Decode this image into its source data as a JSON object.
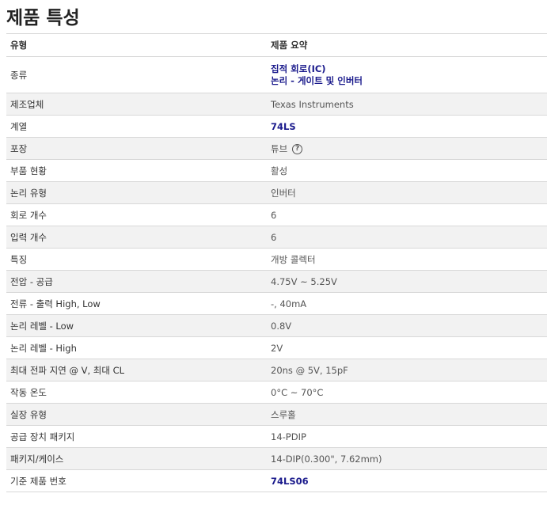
{
  "page_title": "제품 특성",
  "header": {
    "type_label": "유형",
    "summary_label": "제품 요약"
  },
  "rows": [
    {
      "name": "종류",
      "links": [
        "집적 회로(IC)",
        "논리 - 게이트 및 인버터"
      ]
    },
    {
      "name": "제조업체",
      "value": "Texas Instruments"
    },
    {
      "name": "계열",
      "link": "74LS"
    },
    {
      "name": "포장",
      "value": "튜브",
      "help_icon": "question-circle-icon",
      "help_glyph": "?"
    },
    {
      "name": "부품 현황",
      "value": "활성"
    },
    {
      "name": "논리 유형",
      "value": "인버터"
    },
    {
      "name": "회로 개수",
      "value": "6"
    },
    {
      "name": "입력 개수",
      "value": "6"
    },
    {
      "name": "특징",
      "value": "개방 콜렉터"
    },
    {
      "name": "전압 - 공급",
      "value": "4.75V ~ 5.25V"
    },
    {
      "name": "전류 - 출력 High, Low",
      "value": "-, 40mA"
    },
    {
      "name": "논리 레벨 - Low",
      "value": "0.8V"
    },
    {
      "name": "논리 레벨 - High",
      "value": "2V"
    },
    {
      "name": "최대 전파 지연 @ V, 최대 CL",
      "value": "20ns @ 5V, 15pF"
    },
    {
      "name": "작동 온도",
      "value": "0°C ~ 70°C"
    },
    {
      "name": "실장 유형",
      "value": "스루홀"
    },
    {
      "name": "공급 장치 패키지",
      "value": "14-PDIP"
    },
    {
      "name": "패키지/케이스",
      "value": "14-DIP(0.300\", 7.62mm)"
    },
    {
      "name": "기준 제품 번호",
      "link": "74LS06"
    }
  ]
}
